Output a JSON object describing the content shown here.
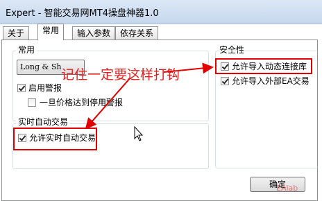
{
  "window": {
    "title": "Expert - 智能交易网MT4操盘神器1.0"
  },
  "tabs": [
    {
      "label": "关于"
    },
    {
      "label": "常用"
    },
    {
      "label": "输入参数"
    },
    {
      "label": "依存关系"
    }
  ],
  "common_group": {
    "title": "常用",
    "dropdown_value": "Long & Sh",
    "enable_alerts_label": "启用警报",
    "disable_alert_once_label": "一旦价格达到停用警报"
  },
  "live_trading": {
    "title": "实时自动交易",
    "allow_live_trading_label": "允许实时自动交易"
  },
  "safety": {
    "title": "安全性",
    "allow_dll_label": "允许导入动态连接库",
    "allow_external_label": "允许导入外部EA交易"
  },
  "annotation": {
    "text": "记住一定要这样打钩"
  },
  "buttons": {
    "ok_label": "确定"
  },
  "watermark": {
    "text": "EAlab"
  },
  "checkboxes": {
    "enable_alerts": true,
    "disable_alert_once": false,
    "allow_live_trading": true,
    "allow_dll": true,
    "allow_external": true
  },
  "colors": {
    "annotation": "#e00000",
    "titlebar": "#c6d8ee"
  }
}
